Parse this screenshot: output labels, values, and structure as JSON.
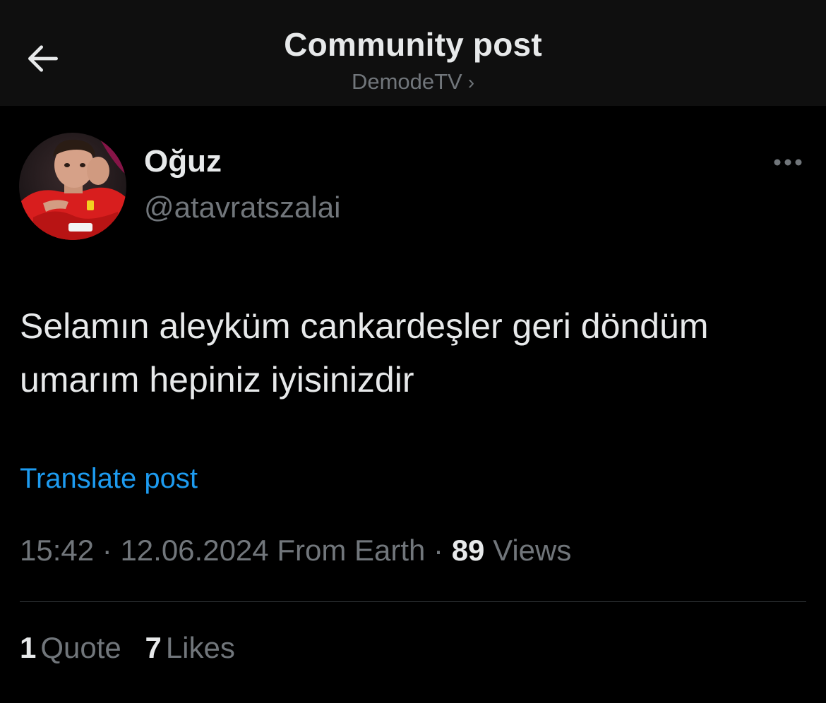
{
  "header": {
    "title": "Community post",
    "community": "DemodeTV",
    "community_chevron": "›",
    "back_icon": "arrow-left-icon"
  },
  "author": {
    "name": "Oğuz",
    "handle": "@atavratszalai",
    "avatar_icon": "avatar-image",
    "more_icon": "more-horizontal-icon"
  },
  "post": {
    "text_line1": "Selamın aleyküm cankardeşler geri döndüm",
    "text_line2": "umarım hepiniz iyisinizdir",
    "translate_label": "Translate post"
  },
  "meta": {
    "time": "15:42",
    "sep1": " · ",
    "date": "12.06.2024",
    "source": " From Earth",
    "sep2": " · ",
    "views_count": "89",
    "views_label": " Views"
  },
  "stats": {
    "quotes_count": "1",
    "quotes_label": "Quote",
    "likes_count": "7",
    "likes_label": "Likes"
  },
  "colors": {
    "background": "#000000",
    "header_bg": "#0f0f0f",
    "primary_text": "#e7e9ea",
    "secondary_text": "#71767b",
    "link": "#1d9bf0",
    "divider": "#2f3336"
  }
}
